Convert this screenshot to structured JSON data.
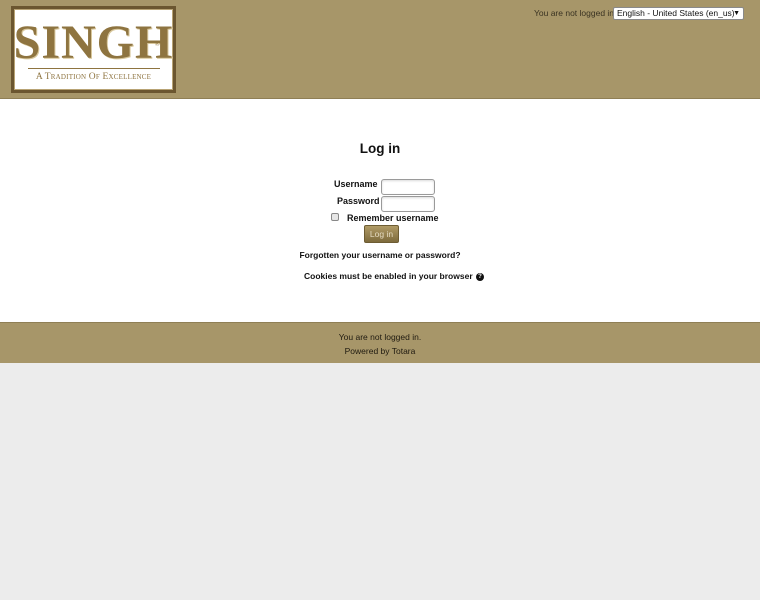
{
  "header": {
    "logo": {
      "word": "SINGH",
      "registered": "®",
      "tagline": "A Tradition Of Excellence"
    },
    "login_status": "You are not logged in.",
    "language": {
      "selected": "English - United States (en_us)",
      "icon": "chevron-down-icon"
    }
  },
  "login": {
    "title": "Log in",
    "username_label": "Username",
    "password_label": "Password",
    "username_value": "",
    "password_value": "",
    "remember_label": "Remember username",
    "remember_checked": false,
    "submit_label": "Log in",
    "forgot_link": "Forgotten your username or password?",
    "cookies_text": "Cookies must be enabled in your browser",
    "help_icon": "help-icon"
  },
  "footer": {
    "login_status": "You are not logged in.",
    "powered_by": "Powered by",
    "powered_link": "Totara"
  },
  "colors": {
    "header_bg": "#a79669",
    "button_gold": "#8a7646",
    "page_bg": "#ececec"
  }
}
